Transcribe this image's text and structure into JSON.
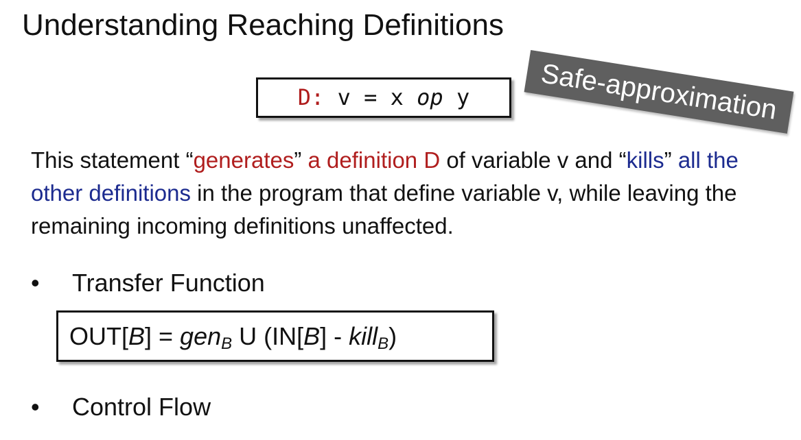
{
  "slide": {
    "title": "Understanding Reaching Definitions",
    "stamp": "Safe-approximation",
    "code": {
      "label": "D:",
      "lhs": "v",
      "equals": "=",
      "x": "x",
      "op": "op",
      "y": "y"
    },
    "paragraph": {
      "p1": "This statement “",
      "generates": "generates",
      "p2": "” ",
      "definition_d": "a definition D",
      "p3": " of variable v and “",
      "kills": "kills",
      "p4": "” ",
      "other_defs": "all the other definitions",
      "p5": " in the program that define variable v, while leaving the remaining incoming definitions unaffected."
    },
    "bullets": [
      {
        "marker": "•",
        "label": "Transfer Function"
      },
      {
        "marker": "•",
        "label": "Control Flow"
      }
    ],
    "formula": {
      "out": "OUT[",
      "b1": "B",
      "p1": "] = ",
      "gen": "gen",
      "gen_sub": "B",
      "p2": " U (IN[",
      "b2": "B",
      "p3": "] - ",
      "kill": "kill",
      "kill_sub": "B",
      "p4": ")"
    }
  }
}
